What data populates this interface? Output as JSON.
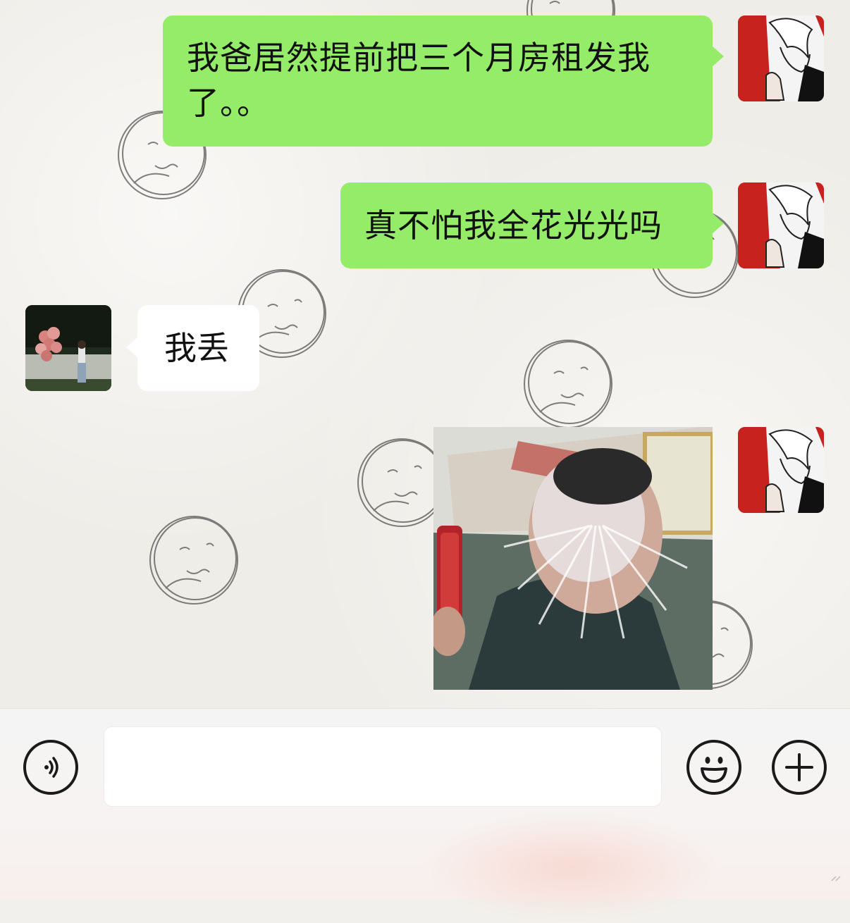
{
  "messages": [
    {
      "sender": "me",
      "type": "text",
      "text_line1": "我爸居然提前把三个月房租发我",
      "text_line2": "了。。"
    },
    {
      "sender": "me",
      "type": "text",
      "text": "真不怕我全花光光吗"
    },
    {
      "sender": "friend",
      "type": "text",
      "text": "我丢"
    },
    {
      "sender": "me",
      "type": "sticker",
      "sticker": "face-splash-sticker"
    }
  ],
  "input_bar": {
    "text_value": "",
    "voice_icon": "voice-icon",
    "emoji_icon": "emoji-icon",
    "plus_icon": "plus-icon"
  },
  "colors": {
    "my_bubble": "#95ec69",
    "friend_bubble": "#ffffff",
    "chat_background": "#efede8",
    "my_avatar": "#c8221e"
  }
}
